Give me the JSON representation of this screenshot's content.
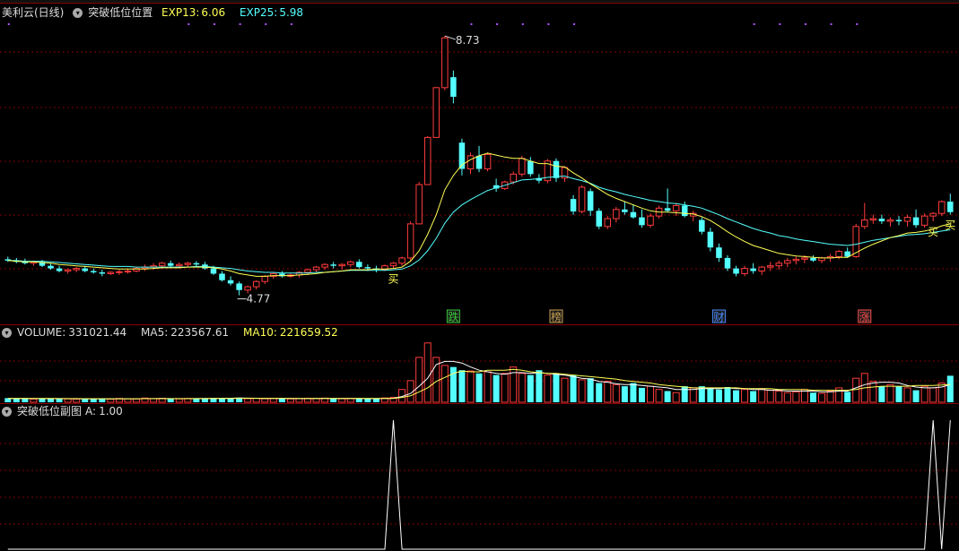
{
  "main_header": {
    "stock_name": "美利云(日线)",
    "indicator_name": "突破低位位置",
    "exp13_label": "EXP13:",
    "exp13_value": "6.06",
    "exp25_label": "EXP25:",
    "exp25_value": "5.98"
  },
  "volume_header": {
    "volume_label": "VOLUME:",
    "volume_value": "331021.44",
    "ma5_label": "MA5:",
    "ma5_value": "223567.61",
    "ma10_label": "MA10:",
    "ma10_value": "221659.52"
  },
  "sub_header": {
    "indicator_name": "突破低位副图",
    "a_label": "A:",
    "a_value": "1.00"
  },
  "colors": {
    "up": "#ff3c3c",
    "down": "#54ffff",
    "exp13": "#ffff55",
    "exp25": "#55ffff",
    "grid": "#800000",
    "signal": "#ffffff",
    "header_text": "#dddddd"
  },
  "chart_data": [
    {
      "type": "candlestick",
      "name": "price",
      "high_label": "8.73",
      "low_label": "4.77",
      "candles": [
        [
          5.32,
          5.36,
          5.28,
          5.3
        ],
        [
          5.3,
          5.34,
          5.26,
          5.28
        ],
        [
          5.28,
          5.33,
          5.24,
          5.26
        ],
        [
          5.26,
          5.3,
          5.22,
          5.28
        ],
        [
          5.28,
          5.31,
          5.2,
          5.22
        ],
        [
          5.22,
          5.26,
          5.16,
          5.18
        ],
        [
          5.18,
          5.22,
          5.12,
          5.14
        ],
        [
          5.14,
          5.18,
          5.1,
          5.16
        ],
        [
          5.16,
          5.2,
          5.12,
          5.18
        ],
        [
          5.18,
          5.22,
          5.12,
          5.14
        ],
        [
          5.14,
          5.18,
          5.1,
          5.12
        ],
        [
          5.12,
          5.16,
          5.06,
          5.1
        ],
        [
          5.1,
          5.14,
          5.08,
          5.12
        ],
        [
          5.12,
          5.16,
          5.08,
          5.13
        ],
        [
          5.13,
          5.18,
          5.1,
          5.14
        ],
        [
          5.14,
          5.2,
          5.12,
          5.18
        ],
        [
          5.18,
          5.24,
          5.14,
          5.2
        ],
        [
          5.2,
          5.26,
          5.16,
          5.22
        ],
        [
          5.22,
          5.28,
          5.18,
          5.26
        ],
        [
          5.26,
          5.3,
          5.2,
          5.22
        ],
        [
          5.22,
          5.27,
          5.18,
          5.24
        ],
        [
          5.24,
          5.28,
          5.2,
          5.26
        ],
        [
          5.26,
          5.29,
          5.2,
          5.24
        ],
        [
          5.24,
          5.28,
          5.16,
          5.18
        ],
        [
          5.18,
          5.22,
          5.08,
          5.1
        ],
        [
          5.1,
          5.14,
          4.98,
          5.0
        ],
        [
          5.0,
          5.06,
          4.92,
          4.95
        ],
        [
          4.95,
          4.98,
          4.77,
          4.85
        ],
        [
          4.85,
          4.92,
          4.8,
          4.9
        ],
        [
          4.9,
          5.0,
          4.86,
          4.98
        ],
        [
          4.98,
          5.08,
          4.94,
          5.06
        ],
        [
          5.06,
          5.12,
          5.02,
          5.1
        ],
        [
          5.1,
          5.14,
          5.04,
          5.06
        ],
        [
          5.06,
          5.1,
          5.04,
          5.08
        ],
        [
          5.08,
          5.14,
          5.04,
          5.12
        ],
        [
          5.12,
          5.18,
          5.08,
          5.16
        ],
        [
          5.16,
          5.22,
          5.12,
          5.2
        ],
        [
          5.2,
          5.26,
          5.16,
          5.24
        ],
        [
          5.24,
          5.28,
          5.18,
          5.22
        ],
        [
          5.22,
          5.26,
          5.16,
          5.24
        ],
        [
          5.24,
          5.3,
          5.2,
          5.28
        ],
        [
          5.28,
          5.32,
          5.18,
          5.2
        ],
        [
          5.2,
          5.24,
          5.14,
          5.18
        ],
        [
          5.18,
          5.22,
          5.12,
          5.16
        ],
        [
          5.16,
          5.24,
          5.14,
          5.22
        ],
        [
          5.22,
          5.28,
          5.18,
          5.26
        ],
        [
          5.26,
          5.36,
          5.22,
          5.34
        ],
        [
          5.34,
          5.9,
          5.3,
          5.86
        ],
        [
          5.86,
          6.5,
          5.86,
          6.46
        ],
        [
          6.46,
          7.2,
          6.46,
          7.18
        ],
        [
          7.18,
          7.95,
          7.18,
          7.94
        ],
        [
          7.94,
          8.73,
          7.9,
          8.7
        ],
        [
          8.1,
          8.2,
          7.7,
          7.8
        ],
        [
          7.1,
          7.16,
          6.6,
          6.7
        ],
        [
          6.7,
          6.95,
          6.62,
          6.9
        ],
        [
          6.9,
          7.05,
          6.65,
          6.7
        ],
        [
          6.7,
          6.95,
          6.66,
          6.92
        ],
        [
          6.45,
          6.55,
          6.35,
          6.4
        ],
        [
          6.4,
          6.52,
          6.38,
          6.5
        ],
        [
          6.5,
          6.66,
          6.46,
          6.62
        ],
        [
          6.62,
          6.9,
          6.58,
          6.86
        ],
        [
          6.82,
          6.88,
          6.58,
          6.62
        ],
        [
          6.56,
          6.62,
          6.48,
          6.52
        ],
        [
          6.52,
          6.85,
          6.48,
          6.82
        ],
        [
          6.82,
          6.86,
          6.5,
          6.56
        ],
        [
          6.56,
          6.74,
          6.5,
          6.72
        ],
        [
          6.24,
          6.3,
          6.0,
          6.05
        ],
        [
          6.05,
          6.45,
          6.02,
          6.42
        ],
        [
          6.36,
          6.4,
          5.98,
          6.06
        ],
        [
          6.06,
          6.1,
          5.78,
          5.82
        ],
        [
          5.82,
          5.98,
          5.78,
          5.94
        ],
        [
          5.94,
          6.12,
          5.88,
          6.08
        ],
        [
          6.08,
          6.2,
          6.0,
          6.04
        ],
        [
          6.04,
          6.16,
          5.94,
          5.96
        ],
        [
          5.96,
          6.08,
          5.8,
          5.84
        ],
        [
          5.84,
          6.02,
          5.8,
          5.98
        ],
        [
          5.98,
          6.14,
          5.94,
          6.1
        ],
        [
          6.1,
          6.4,
          6.04,
          6.06
        ],
        [
          6.06,
          6.18,
          5.98,
          6.14
        ],
        [
          6.14,
          6.2,
          5.96,
          5.98
        ],
        [
          5.98,
          6.06,
          5.9,
          6.02
        ],
        [
          5.92,
          5.96,
          5.7,
          5.74
        ],
        [
          5.74,
          5.8,
          5.44,
          5.5
        ],
        [
          5.5,
          5.56,
          5.28,
          5.34
        ],
        [
          5.34,
          5.38,
          5.14,
          5.18
        ],
        [
          5.18,
          5.22,
          5.06,
          5.1
        ],
        [
          5.1,
          5.22,
          5.06,
          5.18
        ],
        [
          5.18,
          5.26,
          5.1,
          5.14
        ],
        [
          5.14,
          5.22,
          5.08,
          5.2
        ],
        [
          5.2,
          5.28,
          5.14,
          5.22
        ],
        [
          5.22,
          5.3,
          5.16,
          5.26
        ],
        [
          5.26,
          5.34,
          5.2,
          5.3
        ],
        [
          5.3,
          5.36,
          5.24,
          5.32
        ],
        [
          5.32,
          5.38,
          5.26,
          5.34
        ],
        [
          5.34,
          5.38,
          5.28,
          5.3
        ],
        [
          5.3,
          5.36,
          5.26,
          5.34
        ],
        [
          5.34,
          5.4,
          5.28,
          5.36
        ],
        [
          5.36,
          5.46,
          5.32,
          5.44
        ],
        [
          5.44,
          5.5,
          5.34,
          5.36
        ],
        [
          5.36,
          5.86,
          5.34,
          5.82
        ],
        [
          5.82,
          6.18,
          5.78,
          5.92
        ],
        [
          5.92,
          6.0,
          5.86,
          5.94
        ],
        [
          5.94,
          6.0,
          5.86,
          5.9
        ],
        [
          5.9,
          5.96,
          5.82,
          5.92
        ],
        [
          5.92,
          5.98,
          5.84,
          5.9
        ],
        [
          5.9,
          6.0,
          5.82,
          5.96
        ],
        [
          5.96,
          6.08,
          5.8,
          5.84
        ],
        [
          5.84,
          6.02,
          5.8,
          5.98
        ],
        [
          5.98,
          6.04,
          5.9,
          6.02
        ],
        [
          6.02,
          6.22,
          5.98,
          6.2
        ],
        [
          6.2,
          6.32,
          6.0,
          6.04
        ]
      ],
      "exp13": [
        5.3,
        5.29,
        5.28,
        5.28,
        5.27,
        5.26,
        5.24,
        5.23,
        5.22,
        5.21,
        5.2,
        5.19,
        5.18,
        5.17,
        5.17,
        5.17,
        5.17,
        5.18,
        5.19,
        5.19,
        5.19,
        5.2,
        5.2,
        5.2,
        5.19,
        5.17,
        5.14,
        5.1,
        5.08,
        5.06,
        5.06,
        5.07,
        5.07,
        5.07,
        5.08,
        5.09,
        5.1,
        5.12,
        5.13,
        5.14,
        5.16,
        5.16,
        5.16,
        5.17,
        5.17,
        5.18,
        5.2,
        5.29,
        5.45,
        5.7,
        6.0,
        6.38,
        6.6,
        6.76,
        6.84,
        6.9,
        6.94,
        6.91,
        6.88,
        6.86,
        6.86,
        6.82,
        6.78,
        6.78,
        6.74,
        6.73,
        6.64,
        6.56,
        6.47,
        6.39,
        6.31,
        6.25,
        6.2,
        6.15,
        6.1,
        6.06,
        6.04,
        6.04,
        6.03,
        6.02,
        6.01,
        5.97,
        5.91,
        5.83,
        5.74,
        5.66,
        5.59,
        5.53,
        5.49,
        5.45,
        5.41,
        5.39,
        5.37,
        5.36,
        5.35,
        5.34,
        5.34,
        5.35,
        5.35,
        5.42,
        5.49,
        5.55,
        5.6,
        5.65,
        5.68,
        5.72,
        5.73,
        5.75,
        5.78,
        5.83,
        5.86
      ],
      "exp25": [
        5.3,
        5.3,
        5.29,
        5.29,
        5.29,
        5.28,
        5.27,
        5.26,
        5.25,
        5.24,
        5.23,
        5.22,
        5.21,
        5.21,
        5.21,
        5.2,
        5.2,
        5.2,
        5.2,
        5.2,
        5.2,
        5.2,
        5.21,
        5.21,
        5.2,
        5.19,
        5.18,
        5.16,
        5.14,
        5.13,
        5.12,
        5.12,
        5.11,
        5.11,
        5.11,
        5.11,
        5.12,
        5.12,
        5.13,
        5.14,
        5.15,
        5.15,
        5.15,
        5.15,
        5.15,
        5.16,
        5.17,
        5.22,
        5.31,
        5.45,
        5.64,
        5.87,
        6.04,
        6.15,
        6.23,
        6.3,
        6.37,
        6.41,
        6.45,
        6.49,
        6.53,
        6.54,
        6.55,
        6.57,
        6.58,
        6.59,
        6.55,
        6.52,
        6.48,
        6.42,
        6.38,
        6.35,
        6.31,
        6.28,
        6.25,
        6.22,
        6.2,
        6.18,
        6.17,
        6.15,
        6.13,
        6.1,
        6.05,
        6.0,
        5.94,
        5.89,
        5.84,
        5.79,
        5.75,
        5.72,
        5.68,
        5.66,
        5.63,
        5.61,
        5.59,
        5.57,
        5.55,
        5.54,
        5.53,
        5.55,
        5.58,
        5.61,
        5.63,
        5.65,
        5.67,
        5.69,
        5.7,
        5.71,
        5.73,
        5.75,
        5.77
      ],
      "annotations": [
        "8.73",
        "4.77",
        "买",
        "买",
        "买",
        "跌",
        "榜",
        "财",
        "涨"
      ]
    },
    {
      "type": "bar",
      "name": "VOLUME",
      "ma5_label": "MA5",
      "ma10_label": "MA10",
      "values": [
        52,
        46,
        48,
        40,
        44,
        50,
        46,
        42,
        40,
        44,
        42,
        46,
        40,
        48,
        44,
        42,
        52,
        46,
        50,
        44,
        42,
        48,
        46,
        50,
        54,
        48,
        52,
        58,
        46,
        50,
        44,
        48,
        46,
        42,
        46,
        50,
        48,
        52,
        46,
        44,
        48,
        46,
        44,
        50,
        54,
        62,
        160,
        270,
        560,
        740,
        560,
        460,
        440,
        400,
        390,
        360,
        380,
        340,
        360,
        440,
        360,
        340,
        400,
        340,
        360,
        300,
        340,
        280,
        300,
        240,
        260,
        220,
        200,
        240,
        180,
        200,
        160,
        140,
        120,
        200,
        180,
        200,
        180,
        160,
        190,
        150,
        160,
        140,
        170,
        150,
        140,
        120,
        130,
        160,
        120,
        110,
        140,
        180,
        130,
        300,
        360,
        260,
        200,
        220,
        200,
        180,
        150,
        200,
        180,
        240,
        331
      ],
      "ma5": [
        48,
        48,
        47,
        46,
        46,
        46,
        46,
        45,
        44,
        44,
        43,
        44,
        43,
        44,
        44,
        44,
        46,
        46,
        47,
        46,
        46,
        46,
        46,
        47,
        48,
        49,
        50,
        52,
        51,
        50,
        48,
        48,
        47,
        47,
        46,
        46,
        47,
        48,
        48,
        47,
        47,
        47,
        46,
        46,
        48,
        50,
        72,
        110,
        200,
        300,
        470,
        510,
        510,
        490,
        440,
        400,
        380,
        360,
        350,
        370,
        370,
        360,
        370,
        360,
        350,
        340,
        320,
        300,
        290,
        260,
        250,
        230,
        220,
        220,
        210,
        200,
        190,
        180,
        160,
        160,
        160,
        170,
        170,
        170,
        180,
        170,
        170,
        160,
        160,
        150,
        150,
        140,
        140,
        140,
        140,
        130,
        130,
        140,
        140,
        180,
        220,
        240,
        250,
        250,
        240,
        210,
        190,
        180,
        180,
        190,
        220
      ],
      "ma10": [
        48,
        48,
        48,
        47,
        47,
        47,
        46,
        46,
        46,
        45,
        45,
        45,
        44,
        44,
        44,
        44,
        45,
        45,
        45,
        45,
        45,
        45,
        46,
        46,
        47,
        48,
        48,
        49,
        49,
        49,
        49,
        49,
        49,
        48,
        48,
        47,
        47,
        47,
        47,
        47,
        47,
        47,
        47,
        47,
        47,
        48,
        60,
        80,
        130,
        180,
        260,
        310,
        360,
        390,
        380,
        380,
        400,
        400,
        400,
        410,
        400,
        380,
        370,
        360,
        360,
        350,
        340,
        330,
        320,
        310,
        300,
        290,
        270,
        260,
        250,
        240,
        220,
        210,
        200,
        190,
        180,
        180,
        180,
        180,
        180,
        180,
        170,
        170,
        170,
        170,
        160,
        160,
        160,
        160,
        150,
        150,
        150,
        150,
        150,
        160,
        180,
        190,
        200,
        200,
        200,
        200,
        210,
        210,
        210,
        215,
        222
      ]
    },
    {
      "type": "line",
      "name": "A",
      "values": [
        0,
        0,
        0,
        0,
        0,
        0,
        0,
        0,
        0,
        0,
        0,
        0,
        0,
        0,
        0,
        0,
        0,
        0,
        0,
        0,
        0,
        0,
        0,
        0,
        0,
        0,
        0,
        0,
        0,
        0,
        0,
        0,
        0,
        0,
        0,
        0,
        0,
        0,
        0,
        0,
        0,
        0,
        0,
        0,
        0,
        1,
        0,
        0,
        0,
        0,
        0,
        0,
        0,
        0,
        0,
        0,
        0,
        0,
        0,
        0,
        0,
        0,
        0,
        0,
        0,
        0,
        0,
        0,
        0,
        0,
        0,
        0,
        0,
        0,
        0,
        0,
        0,
        0,
        0,
        0,
        0,
        0,
        0,
        0,
        0,
        0,
        0,
        0,
        0,
        0,
        0,
        0,
        0,
        0,
        0,
        0,
        0,
        0,
        0,
        0,
        0,
        0,
        0,
        0,
        0,
        0,
        0,
        0,
        1,
        0,
        1
      ]
    }
  ]
}
